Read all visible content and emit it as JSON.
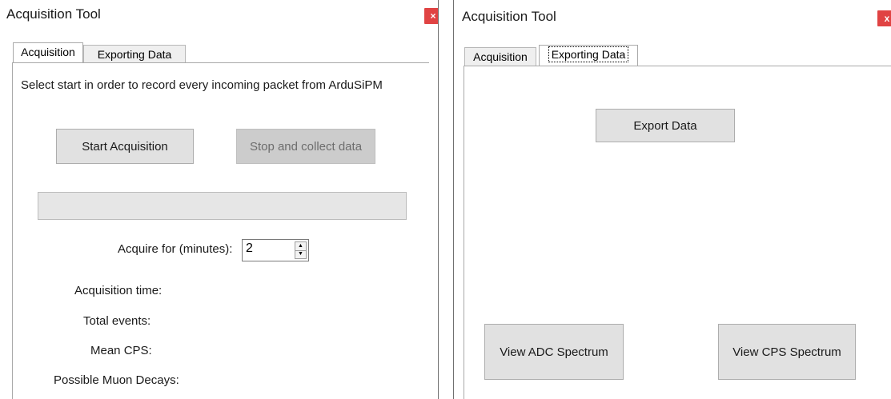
{
  "left_window": {
    "title": "Acquisition Tool",
    "close_glyph": "×",
    "tabs": [
      {
        "label": "Acquisition",
        "active": true
      },
      {
        "label": "Exporting Data",
        "active": false
      }
    ],
    "instruction": "Select start in order to record every incoming packet from ArduSiPM",
    "start_button": "Start Acquisition",
    "stop_button": "Stop and collect data",
    "progress": 0,
    "acquire_label": "Acquire for (minutes):",
    "acquire_value": "2",
    "stats": [
      {
        "label": "Acquisition time:"
      },
      {
        "label": "Total events:"
      },
      {
        "label": "Mean CPS:"
      },
      {
        "label": "Possible Muon Decays:"
      }
    ]
  },
  "right_window": {
    "title": "Acquisition Tool",
    "close_glyph": "x",
    "tabs": [
      {
        "label": "Acquisition",
        "active": false
      },
      {
        "label": "Exporting Data",
        "active": true
      }
    ],
    "export_button": "Export Data",
    "view_adc_button": "View ADC Spectrum",
    "view_cps_button": "View CPS Spectrum"
  },
  "colors": {
    "close_button": "#e04343",
    "button_face": "#e1e1e1",
    "disabled_button": "#cccccc"
  }
}
